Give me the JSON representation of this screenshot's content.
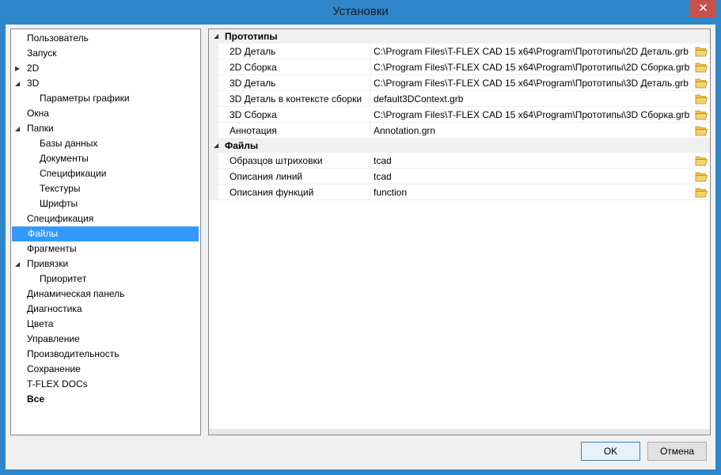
{
  "window": {
    "title": "Установки",
    "close_glyph": "✕"
  },
  "tree": {
    "items": [
      {
        "label": "Пользователь",
        "level": 0,
        "expander": ""
      },
      {
        "label": "Запуск",
        "level": 0,
        "expander": ""
      },
      {
        "label": "2D",
        "level": 0,
        "expander": "▶"
      },
      {
        "label": "3D",
        "level": 0,
        "expander": "◢"
      },
      {
        "label": "Параметры графики",
        "level": 1,
        "expander": ""
      },
      {
        "label": "Окна",
        "level": 0,
        "expander": ""
      },
      {
        "label": "Папки",
        "level": 0,
        "expander": "◢"
      },
      {
        "label": "Базы данных",
        "level": 1,
        "expander": ""
      },
      {
        "label": "Документы",
        "level": 1,
        "expander": ""
      },
      {
        "label": "Спецификации",
        "level": 1,
        "expander": ""
      },
      {
        "label": "Текстуры",
        "level": 1,
        "expander": ""
      },
      {
        "label": "Шрифты",
        "level": 1,
        "expander": ""
      },
      {
        "label": "Спецификация",
        "level": 0,
        "expander": ""
      },
      {
        "label": "Файлы",
        "level": 0,
        "expander": "",
        "selected": true
      },
      {
        "label": "Фрагменты",
        "level": 0,
        "expander": ""
      },
      {
        "label": "Привязки",
        "level": 0,
        "expander": "◢"
      },
      {
        "label": "Приоритет",
        "level": 1,
        "expander": ""
      },
      {
        "label": "Динамическая панель",
        "level": 0,
        "expander": ""
      },
      {
        "label": "Диагностика",
        "level": 0,
        "expander": ""
      },
      {
        "label": "Цвета",
        "level": 0,
        "expander": ""
      },
      {
        "label": "Управление",
        "level": 0,
        "expander": ""
      },
      {
        "label": "Производительность",
        "level": 0,
        "expander": ""
      },
      {
        "label": "Сохранение",
        "level": 0,
        "expander": ""
      },
      {
        "label": "T-FLEX DOCs",
        "level": 0,
        "expander": ""
      },
      {
        "label": "Все",
        "level": 0,
        "expander": "",
        "bold": true
      }
    ]
  },
  "grid": {
    "categories": [
      {
        "label": "Прототипы",
        "expander": "◢",
        "rows": [
          {
            "name": "2D Деталь",
            "value": "C:\\Program Files\\T-FLEX CAD 15 x64\\Program\\Прототипы\\2D Деталь.grb"
          },
          {
            "name": "2D Сборка",
            "value": "C:\\Program Files\\T-FLEX CAD 15 x64\\Program\\Прототипы\\2D Сборка.grb"
          },
          {
            "name": "3D Деталь",
            "value": "C:\\Program Files\\T-FLEX CAD 15 x64\\Program\\Прототипы\\3D Деталь.grb"
          },
          {
            "name": "3D Деталь в контексте сборки",
            "value": "default3DContext.grb"
          },
          {
            "name": "3D Сборка",
            "value": "C:\\Program Files\\T-FLEX CAD 15 x64\\Program\\Прототипы\\3D Сборка.grb"
          },
          {
            "name": "Аннотация",
            "value": "Annotation.grn"
          }
        ]
      },
      {
        "label": "Файлы",
        "expander": "◢",
        "rows": [
          {
            "name": "Образцов штриховки",
            "value": "tcad"
          },
          {
            "name": "Описания линий",
            "value": "tcad"
          },
          {
            "name": "Описания функций",
            "value": "function"
          }
        ]
      }
    ],
    "row_icon": "folder-open-icon"
  },
  "buttons": {
    "ok": "OK",
    "cancel": "Отмена"
  },
  "colors": {
    "titlebar": "#2e86c9",
    "selection": "#3399ff",
    "close": "#c7504b",
    "folder": "#e8b53c"
  }
}
